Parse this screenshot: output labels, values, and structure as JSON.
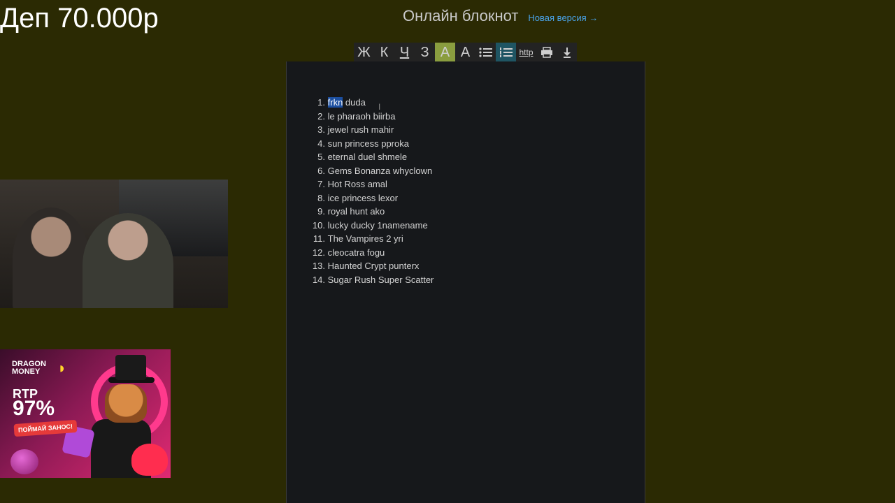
{
  "overlay": {
    "title": "Деп 70.000р"
  },
  "header": {
    "title": "Онлайн блокнот",
    "new_version_link": "Новая версия →"
  },
  "toolbar": {
    "buttons": [
      {
        "label": "Ж",
        "icon": "bold-icon"
      },
      {
        "label": "К",
        "icon": "italic-icon"
      },
      {
        "label": "Ч",
        "icon": "underline-icon"
      },
      {
        "label": "З",
        "icon": "strikethrough-icon"
      },
      {
        "label": "A",
        "icon": "highlight-icon"
      },
      {
        "label": "A",
        "icon": "text-color-icon"
      },
      {
        "label": "☰",
        "icon": "bullet-list-icon"
      },
      {
        "label": "☰",
        "icon": "numbered-list-icon"
      },
      {
        "label": "http",
        "icon": "link-icon"
      },
      {
        "label": "🖶",
        "icon": "print-icon"
      },
      {
        "label": "⭳",
        "icon": "download-icon"
      }
    ]
  },
  "editor": {
    "items": [
      {
        "num": "1.",
        "selected": "frkn",
        "text": " duda"
      },
      {
        "num": "2.",
        "text": "le pharaoh biirba"
      },
      {
        "num": "3.",
        "text": "jewel rush mahir"
      },
      {
        "num": "4.",
        "text": "sun princess pproka"
      },
      {
        "num": "5.",
        "text": "eternal duel shmele"
      },
      {
        "num": "6.",
        "text": "Gems Bonanza whyclown"
      },
      {
        "num": "7.",
        "text": "Hot Ross amal"
      },
      {
        "num": "8.",
        "text": "ice princess lexor"
      },
      {
        "num": "9.",
        "text": "royal hunt ako"
      },
      {
        "num": "10.",
        "text": "lucky ducky 1namename"
      },
      {
        "num": "11.",
        "text": "The Vampires 2 yri"
      },
      {
        "num": "12.",
        "text": "cleocatra fogu"
      },
      {
        "num": "13.",
        "text": "Haunted Crypt punterx"
      },
      {
        "num": "14.",
        "text": "Sugar Rush Super Scatter"
      }
    ]
  },
  "ad": {
    "brand": "DRAGON\nMONEY",
    "rtp_label": "RTP",
    "rtp_value": "97%",
    "cta": "ПОЙМАЙ ЗАНОС!"
  }
}
